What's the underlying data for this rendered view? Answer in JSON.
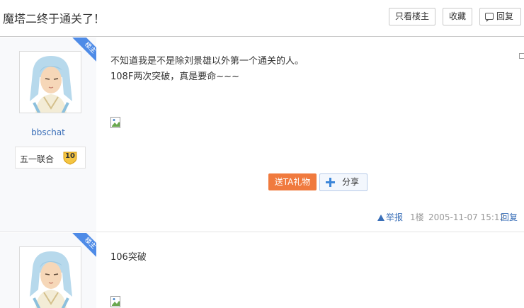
{
  "header": {
    "title": "魔塔二终于通关了！",
    "only_author_label": "只看楼主",
    "favorite_label": "收藏",
    "reply_label": "回复"
  },
  "posts": [
    {
      "badge": "楼主",
      "username": "bbschat",
      "rank_name": "五一联合",
      "rank_level": "10",
      "lines": [
        "不知道我是不是除刘景雄以外第一个通关的人。",
        "108F两次突破，真是要命~~~"
      ],
      "gift_label": "送TA礼物",
      "share_label": "分享",
      "report_label": "举报",
      "floor": "1楼",
      "time": "2005-11-07 15:12",
      "reply_label": "回复"
    },
    {
      "badge": "楼主",
      "lines": [
        "106突破"
      ]
    }
  ],
  "colors": {
    "accent": "#3a6fb8",
    "gift": "#f07a3e",
    "badge": "#4e8be7"
  }
}
